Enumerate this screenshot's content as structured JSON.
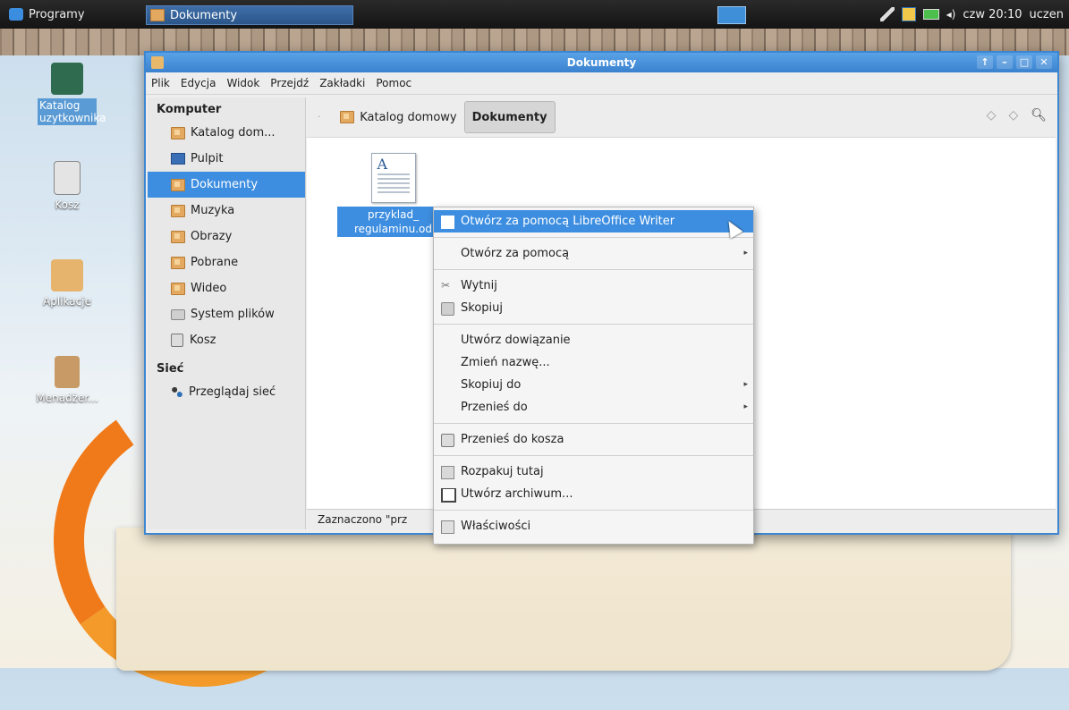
{
  "panel": {
    "menu_label": "Programy",
    "task_label": "Dokumenty",
    "clock": "czw 20:10",
    "user": "uczen"
  },
  "desktop": {
    "icons": [
      {
        "label": "Katalog uzytkownika"
      },
      {
        "label": "Kosz"
      },
      {
        "label": "Aplikacje"
      },
      {
        "label": "Menadżer..."
      }
    ]
  },
  "window": {
    "title": "Dokumenty",
    "menu": [
      "Plik",
      "Edycja",
      "Widok",
      "Przejdź",
      "Zakładki",
      "Pomoc"
    ],
    "sidebar": {
      "section_computer": "Komputer",
      "items": [
        {
          "label": "Katalog dom..."
        },
        {
          "label": "Pulpit"
        },
        {
          "label": "Dokumenty"
        },
        {
          "label": "Muzyka"
        },
        {
          "label": "Obrazy"
        },
        {
          "label": "Pobrane"
        },
        {
          "label": "Wideo"
        },
        {
          "label": "System plików"
        },
        {
          "label": "Kosz"
        }
      ],
      "section_network": "Sieć",
      "network_item": "Przeglądaj sieć"
    },
    "path": {
      "home": "Katalog domowy",
      "current": "Dokumenty"
    },
    "file": {
      "name_line1": "przyklad_",
      "name_line2": "regulaminu.od"
    },
    "status": "Zaznaczono \"prz"
  },
  "context_menu": {
    "items": [
      "Otwórz za pomocą LibreOffice Writer",
      "Otwórz za pomocą",
      "Wytnij",
      "Skopiuj",
      "Utwórz dowiązanie",
      "Zmień nazwę...",
      "Skopiuj do",
      "Przenieś do",
      "Przenieś do kosza",
      "Rozpakuj tutaj",
      "Utwórz archiwum...",
      "Właściwości"
    ]
  },
  "colors": {
    "selection": "#3d8ee0",
    "titlebar": "#3a82cf"
  }
}
